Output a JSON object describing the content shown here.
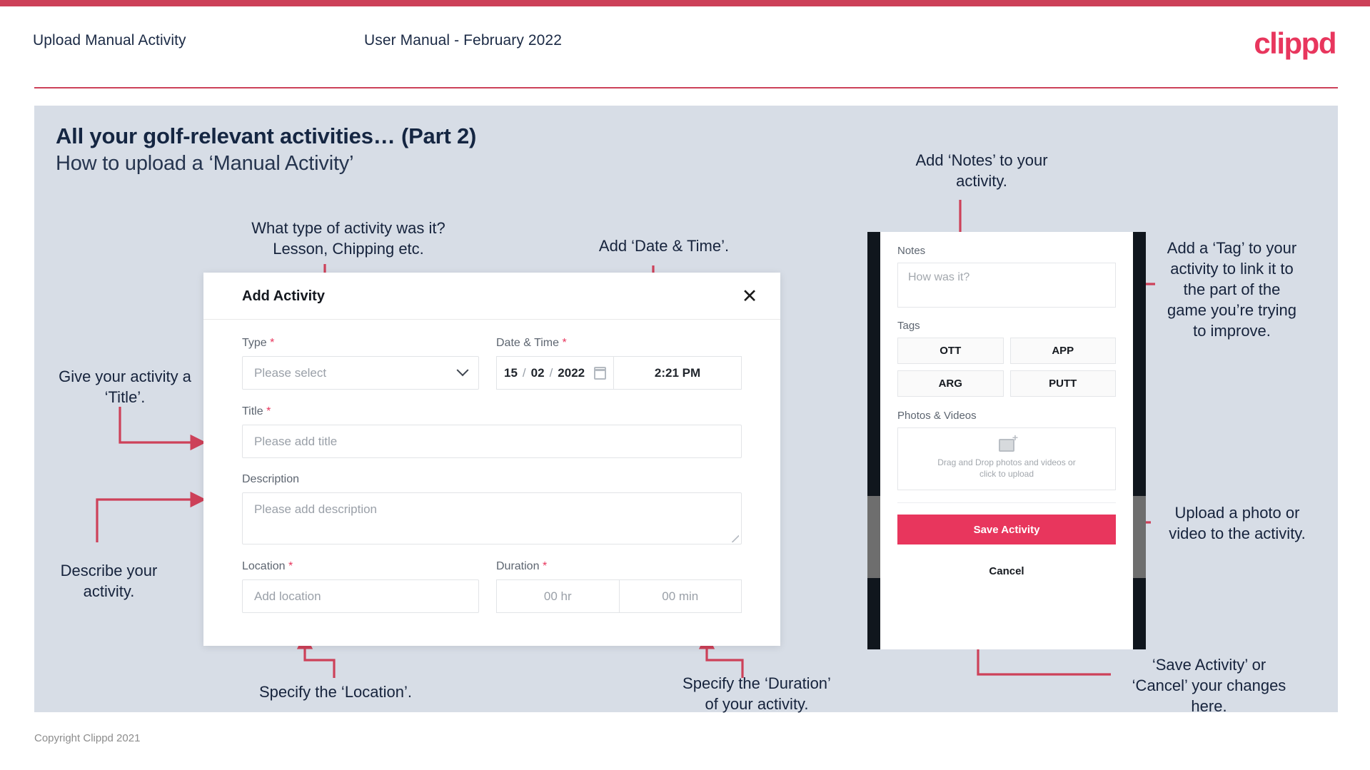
{
  "header": {
    "title": "Upload Manual Activity",
    "subtitle": "User Manual - February 2022",
    "logo": "clippd"
  },
  "slide": {
    "heading": "All your golf-relevant activities… (Part 2)",
    "subheading": "How to upload a ‘Manual Activity’"
  },
  "footer": {
    "copyright": "Copyright Clippd 2021"
  },
  "colors": {
    "brand_red": "#e8365d",
    "bar_red": "#cd4159",
    "slide_bg": "#d7dde6",
    "text_dark": "#16233c",
    "connector": "#cd4159"
  },
  "modal": {
    "title": "Add Activity",
    "close_icon": "✕",
    "fields": {
      "type": {
        "label": "Type",
        "required": "*",
        "placeholder": "Please select",
        "icon": "chevron-down-icon"
      },
      "datetime": {
        "label": "Date & Time",
        "required": "*",
        "day": "15",
        "month": "02",
        "year": "2022",
        "sep": "/",
        "time": "2:21 PM",
        "icon": "calendar-icon"
      },
      "title": {
        "label": "Title",
        "required": "*",
        "placeholder": "Please add title"
      },
      "description": {
        "label": "Description",
        "required": "",
        "placeholder": "Please add description"
      },
      "location": {
        "label": "Location",
        "required": "*",
        "placeholder": "Add location"
      },
      "duration": {
        "label": "Duration",
        "required": "*",
        "hours_placeholder": "00 hr",
        "minutes_placeholder": "00 min"
      }
    }
  },
  "phone": {
    "notes": {
      "label": "Notes",
      "placeholder": "How was it?"
    },
    "tags": {
      "label": "Tags",
      "items": [
        "OTT",
        "APP",
        "ARG",
        "PUTT"
      ]
    },
    "photos": {
      "label": "Photos & Videos",
      "dropzone_line1": "Drag and Drop photos and videos or",
      "dropzone_line2": "click to upload",
      "icon": "add-image-icon"
    },
    "save_label": "Save Activity",
    "cancel_label": "Cancel"
  },
  "annotations": {
    "type": "What type of activity was it?\nLesson, Chipping etc.",
    "datetime": "Add ‘Date & Time’.",
    "title": "Give your activity a\n‘Title’.",
    "description": "Describe your\nactivity.",
    "location": "Specify the ‘Location’.",
    "duration": "Specify the ‘Duration’\nof your activity.",
    "notes": "Add ‘Notes’ to your\nactivity.",
    "tags": "Add a ‘Tag’ to your\nactivity to link it to\nthe part of the\ngame you’re trying\nto improve.",
    "photos": "Upload a photo or\nvideo to the activity.",
    "save": "‘Save Activity’ or\n‘Cancel’ your changes\nhere."
  }
}
